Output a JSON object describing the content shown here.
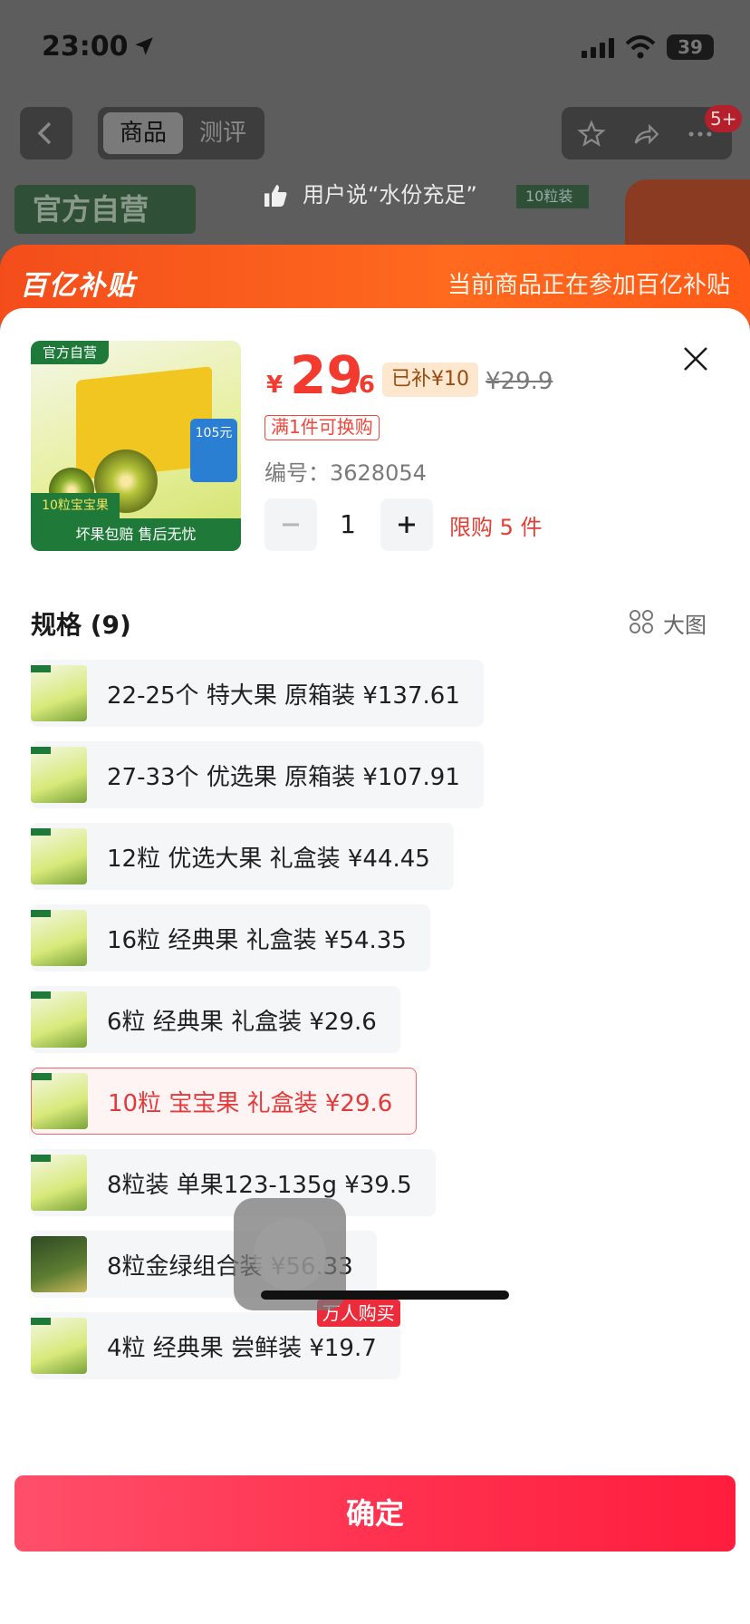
{
  "status_bar": {
    "time": "23:00",
    "battery": "39"
  },
  "top_nav": {
    "tabs": [
      {
        "label": "商品"
      },
      {
        "label": "测评"
      }
    ],
    "notification_badge": "5+"
  },
  "background": {
    "banner_text": "官方自营",
    "review_text": "用户说“水份充足”",
    "pack_tag": "10粒装"
  },
  "subsidy_banner": {
    "logo": "百亿补贴",
    "message": "当前商品正在参加百亿补贴"
  },
  "product": {
    "image_tag": "官方自营",
    "image_badge": "105元",
    "image_left_tag": "10粒宝宝果",
    "image_bottom": "坏果包赔 售后无忧",
    "currency": "¥",
    "price_int": "29",
    "price_dec": ".6",
    "subsidy_badge": "已补¥10",
    "original_price": "¥29.9",
    "promo": "满1件可换购",
    "sku_label": "编号：",
    "sku_number": "3628054"
  },
  "quantity": {
    "value": "1",
    "limit": "限购 5 件"
  },
  "specs": {
    "title": "规格 (9)",
    "big_view_label": "大图",
    "items": [
      {
        "label": "22-25个 特大果 原箱装 ¥137.61"
      },
      {
        "label": "27-33个 优选果 原箱装 ¥107.91"
      },
      {
        "label": "12粒 优选大果 礼盒装 ¥44.45"
      },
      {
        "label": "16粒 经典果 礼盒装 ¥54.35"
      },
      {
        "label": "6粒 经典果 礼盒装 ¥29.6"
      },
      {
        "label": "10粒 宝宝果 礼盒装 ¥29.6"
      },
      {
        "label": "8粒装 单果123-135g ¥39.5"
      },
      {
        "label": "8粒金绿组合装 ¥56.33"
      },
      {
        "label": "4粒 经典果 尝鲜装 ¥19.7",
        "badge": "万人购买"
      }
    ],
    "selected_index": 5
  },
  "confirm": {
    "label": "确定"
  },
  "colors": {
    "accent": "#f23b2e",
    "subsidy": "#ff6a1e",
    "confirm": "#ff3250"
  }
}
